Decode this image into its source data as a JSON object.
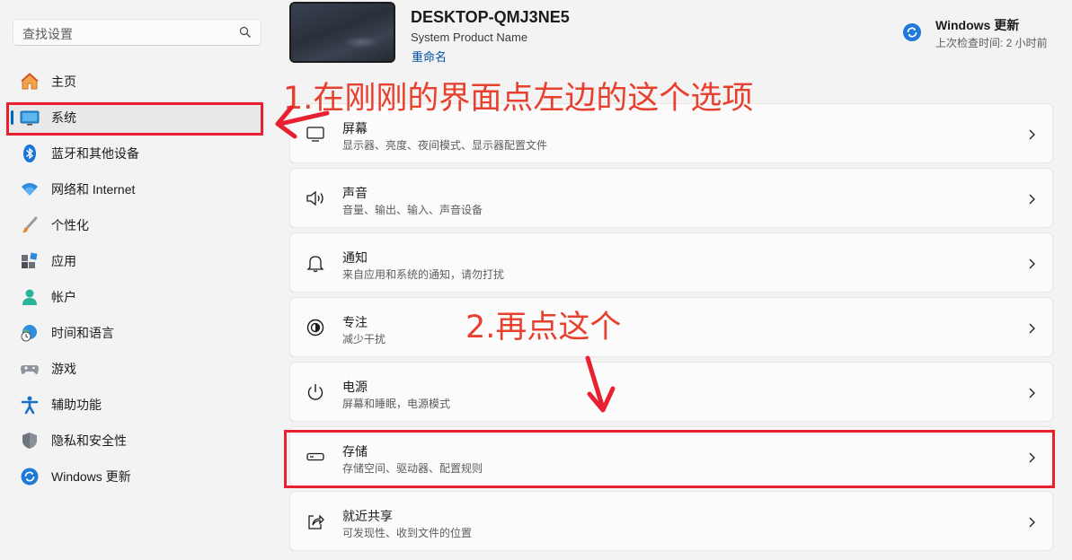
{
  "search": {
    "placeholder": "查找设置",
    "icon": "search-icon"
  },
  "sidebar": {
    "items": [
      {
        "label": "主页",
        "icon": "home-icon"
      },
      {
        "label": "系统",
        "icon": "system-icon",
        "active": true
      },
      {
        "label": "蓝牙和其他设备",
        "icon": "bluetooth-icon"
      },
      {
        "label": "网络和 Internet",
        "icon": "wifi-icon"
      },
      {
        "label": "个性化",
        "icon": "brush-icon"
      },
      {
        "label": "应用",
        "icon": "apps-icon"
      },
      {
        "label": "帐户",
        "icon": "account-icon"
      },
      {
        "label": "时间和语言",
        "icon": "globe-clock-icon"
      },
      {
        "label": "游戏",
        "icon": "gamepad-icon"
      },
      {
        "label": "辅助功能",
        "icon": "accessibility-icon"
      },
      {
        "label": "隐私和安全性",
        "icon": "shield-icon"
      },
      {
        "label": "Windows 更新",
        "icon": "update-icon"
      }
    ]
  },
  "header": {
    "device_name": "DESKTOP-QMJ3NE5",
    "device_model": "System Product Name",
    "rename": "重命名",
    "update_title": "Windows 更新",
    "update_subtitle": "上次检查时间: 2 小时前"
  },
  "cards": [
    {
      "title": "屏幕",
      "desc": "显示器、亮度、夜间模式、显示器配置文件",
      "icon": "monitor-icon"
    },
    {
      "title": "声音",
      "desc": "音量、输出、输入、声音设备",
      "icon": "speaker-icon"
    },
    {
      "title": "通知",
      "desc": "来自应用和系统的通知，请勿打扰",
      "icon": "bell-icon"
    },
    {
      "title": "专注",
      "desc": "减少干扰",
      "icon": "focus-icon"
    },
    {
      "title": "电源",
      "desc": "屏幕和睡眠，电源模式",
      "icon": "power-icon"
    },
    {
      "title": "存储",
      "desc": "存储空间、驱动器、配置规则",
      "icon": "storage-icon"
    },
    {
      "title": "就近共享",
      "desc": "可发现性、收到文件的位置",
      "icon": "share-icon"
    }
  ],
  "annotations": {
    "step1": "1.在刚刚的界面点左边的这个选项",
    "step2": "2.再点这个",
    "color": "#e8202f"
  },
  "colors": {
    "accent": "#0067c0",
    "link": "#0050a8"
  }
}
